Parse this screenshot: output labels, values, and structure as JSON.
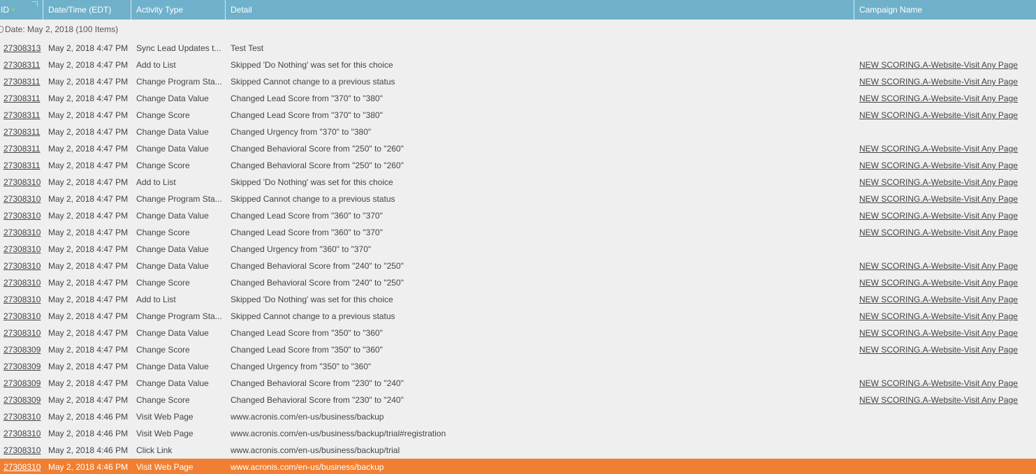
{
  "header": {
    "id": "ID",
    "datetime": "Date/Time (EDT)",
    "activity_type": "Activity Type",
    "detail": "Detail",
    "campaign": "Campaign Name"
  },
  "group": {
    "label": "Date: May 2, 2018 (100 Items)"
  },
  "rows": [
    {
      "id": "27308313",
      "datetime": "May 2, 2018 4:47 PM",
      "type": "Sync Lead Updates t...",
      "detail": "Test Test",
      "campaign": ""
    },
    {
      "id": "27308311",
      "datetime": "May 2, 2018 4:47 PM",
      "type": "Add to List",
      "detail": "Skipped 'Do Nothing' was set for this choice",
      "campaign": "NEW SCORING.A-Website-Visit Any Page"
    },
    {
      "id": "27308311",
      "datetime": "May 2, 2018 4:47 PM",
      "type": "Change Program Sta...",
      "detail": "Skipped Cannot change to a previous status",
      "campaign": "NEW SCORING.A-Website-Visit Any Page"
    },
    {
      "id": "27308311",
      "datetime": "May 2, 2018 4:47 PM",
      "type": "Change Data Value",
      "detail": "Changed Lead Score from \"370\" to \"380\"",
      "campaign": "NEW SCORING.A-Website-Visit Any Page"
    },
    {
      "id": "27308311",
      "datetime": "May 2, 2018 4:47 PM",
      "type": "Change Score",
      "detail": "Changed Lead Score from \"370\" to \"380\"",
      "campaign": "NEW SCORING.A-Website-Visit Any Page"
    },
    {
      "id": "27308311",
      "datetime": "May 2, 2018 4:47 PM",
      "type": "Change Data Value",
      "detail": "Changed Urgency from \"370\" to \"380\"",
      "campaign": ""
    },
    {
      "id": "27308311",
      "datetime": "May 2, 2018 4:47 PM",
      "type": "Change Data Value",
      "detail": "Changed Behavioral Score from \"250\" to \"260\"",
      "campaign": "NEW SCORING.A-Website-Visit Any Page"
    },
    {
      "id": "27308311",
      "datetime": "May 2, 2018 4:47 PM",
      "type": "Change Score",
      "detail": "Changed Behavioral Score from \"250\" to \"260\"",
      "campaign": "NEW SCORING.A-Website-Visit Any Page"
    },
    {
      "id": "27308310",
      "datetime": "May 2, 2018 4:47 PM",
      "type": "Add to List",
      "detail": "Skipped 'Do Nothing' was set for this choice",
      "campaign": "NEW SCORING.A-Website-Visit Any Page"
    },
    {
      "id": "27308310",
      "datetime": "May 2, 2018 4:47 PM",
      "type": "Change Program Sta...",
      "detail": "Skipped Cannot change to a previous status",
      "campaign": "NEW SCORING.A-Website-Visit Any Page"
    },
    {
      "id": "27308310",
      "datetime": "May 2, 2018 4:47 PM",
      "type": "Change Data Value",
      "detail": "Changed Lead Score from \"360\" to \"370\"",
      "campaign": "NEW SCORING.A-Website-Visit Any Page"
    },
    {
      "id": "27308310",
      "datetime": "May 2, 2018 4:47 PM",
      "type": "Change Score",
      "detail": "Changed Lead Score from \"360\" to \"370\"",
      "campaign": "NEW SCORING.A-Website-Visit Any Page"
    },
    {
      "id": "27308310",
      "datetime": "May 2, 2018 4:47 PM",
      "type": "Change Data Value",
      "detail": "Changed Urgency from \"360\" to \"370\"",
      "campaign": ""
    },
    {
      "id": "27308310",
      "datetime": "May 2, 2018 4:47 PM",
      "type": "Change Data Value",
      "detail": "Changed Behavioral Score from \"240\" to \"250\"",
      "campaign": "NEW SCORING.A-Website-Visit Any Page"
    },
    {
      "id": "27308310",
      "datetime": "May 2, 2018 4:47 PM",
      "type": "Change Score",
      "detail": "Changed Behavioral Score from \"240\" to \"250\"",
      "campaign": "NEW SCORING.A-Website-Visit Any Page"
    },
    {
      "id": "27308310",
      "datetime": "May 2, 2018 4:47 PM",
      "type": "Add to List",
      "detail": "Skipped 'Do Nothing' was set for this choice",
      "campaign": "NEW SCORING.A-Website-Visit Any Page"
    },
    {
      "id": "27308310",
      "datetime": "May 2, 2018 4:47 PM",
      "type": "Change Program Sta...",
      "detail": "Skipped Cannot change to a previous status",
      "campaign": "NEW SCORING.A-Website-Visit Any Page"
    },
    {
      "id": "27308310",
      "datetime": "May 2, 2018 4:47 PM",
      "type": "Change Data Value",
      "detail": "Changed Lead Score from \"350\" to \"360\"",
      "campaign": "NEW SCORING.A-Website-Visit Any Page"
    },
    {
      "id": "27308309",
      "datetime": "May 2, 2018 4:47 PM",
      "type": "Change Score",
      "detail": "Changed Lead Score from \"350\" to \"360\"",
      "campaign": "NEW SCORING.A-Website-Visit Any Page"
    },
    {
      "id": "27308309",
      "datetime": "May 2, 2018 4:47 PM",
      "type": "Change Data Value",
      "detail": "Changed Urgency from \"350\" to \"360\"",
      "campaign": ""
    },
    {
      "id": "27308309",
      "datetime": "May 2, 2018 4:47 PM",
      "type": "Change Data Value",
      "detail": "Changed Behavioral Score from \"230\" to \"240\"",
      "campaign": "NEW SCORING.A-Website-Visit Any Page"
    },
    {
      "id": "27308309",
      "datetime": "May 2, 2018 4:47 PM",
      "type": "Change Score",
      "detail": "Changed Behavioral Score from \"230\" to \"240\"",
      "campaign": "NEW SCORING.A-Website-Visit Any Page"
    },
    {
      "id": "27308310",
      "datetime": "May 2, 2018 4:46 PM",
      "type": "Visit Web Page",
      "detail": "www.acronis.com/en-us/business/backup",
      "campaign": ""
    },
    {
      "id": "27308310",
      "datetime": "May 2, 2018 4:46 PM",
      "type": "Visit Web Page",
      "detail": "www.acronis.com/en-us/business/backup/trial#registration",
      "campaign": ""
    },
    {
      "id": "27308310",
      "datetime": "May 2, 2018 4:46 PM",
      "type": "Click Link",
      "detail": "www.acronis.com/en-us/business/backup/trial",
      "campaign": ""
    },
    {
      "id": "27308310",
      "datetime": "May 2, 2018 4:46 PM",
      "type": "Visit Web Page",
      "detail": "www.acronis.com/en-us/business/backup",
      "campaign": "",
      "selected": true
    }
  ],
  "colors": {
    "header_bg": "#6fb1cb",
    "selected_row_bg": "#ef7f32",
    "body_bg": "#efefef"
  }
}
